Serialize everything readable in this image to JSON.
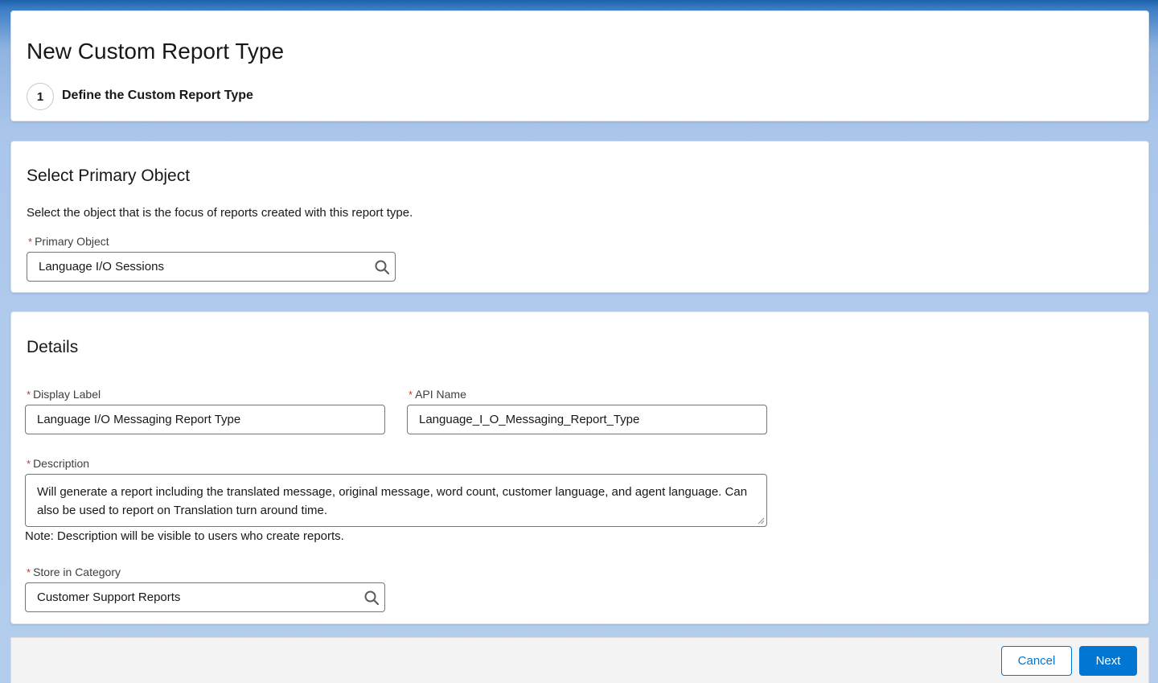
{
  "header": {
    "title": "New Custom Report Type",
    "step_number": "1",
    "step_label": "Define the Custom Report Type"
  },
  "primary_object_section": {
    "title": "Select Primary Object",
    "description": "Select the object that is the focus of reports created with this report type.",
    "field_label": "Primary Object",
    "field_value": "Language I/O Sessions",
    "required_marker": "*"
  },
  "details_section": {
    "title": "Details",
    "display_label": {
      "label": "Display Label",
      "value": "Language I/O Messaging Report Type"
    },
    "api_name": {
      "label": "API Name",
      "value": "Language_I_O_Messaging_Report_Type"
    },
    "description": {
      "label": "Description",
      "value": "Will generate a report including the translated message, original message, word count, customer language, and agent language. Can also be used to report on Translation turn around time.",
      "note": "Note: Description will be visible to users who create reports."
    },
    "category": {
      "label": "Store in Category",
      "value": "Customer Support Reports"
    },
    "required_marker": "*"
  },
  "footer": {
    "cancel_label": "Cancel",
    "next_label": "Next"
  },
  "colors": {
    "brand": "#0176d3",
    "required": "#c23934"
  },
  "icons": {
    "lookup": "search-icon",
    "resize": "resize-handle-icon"
  }
}
